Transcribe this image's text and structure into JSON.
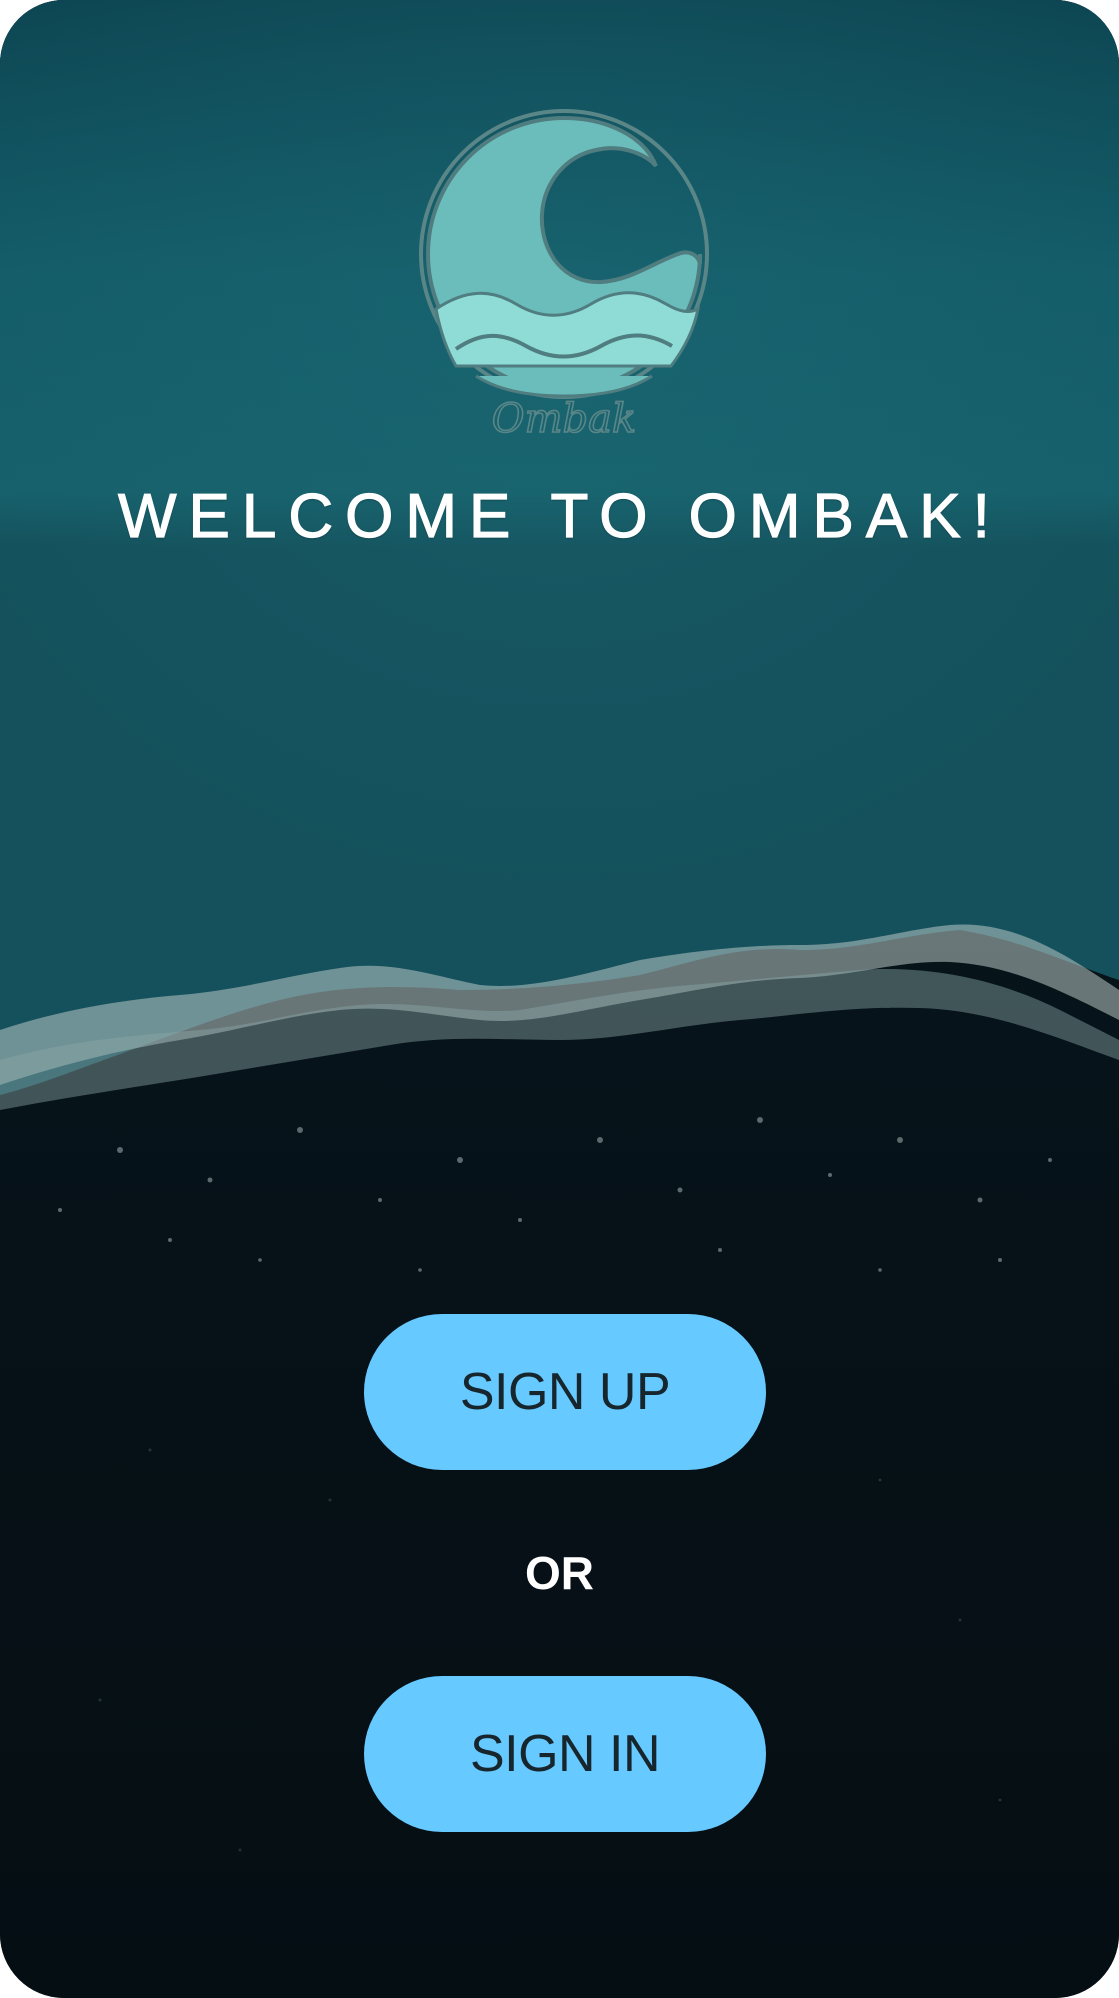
{
  "app": {
    "welcome_text": "WELCOME TO OMBAK!",
    "logo_text": "Ombak"
  },
  "actions": {
    "sign_up_label": "SIGN UP",
    "or_label": "OR",
    "sign_in_label": "SIGN IN"
  },
  "colors": {
    "accent": "#66c9ff",
    "sea_top": "#0f4a57",
    "sea_mid": "#17606b",
    "sand": "#06121a",
    "logo_teal": "#6abfbd",
    "logo_light": "#8fdcd6"
  },
  "icons": {
    "logo": "wave-logo-icon"
  }
}
